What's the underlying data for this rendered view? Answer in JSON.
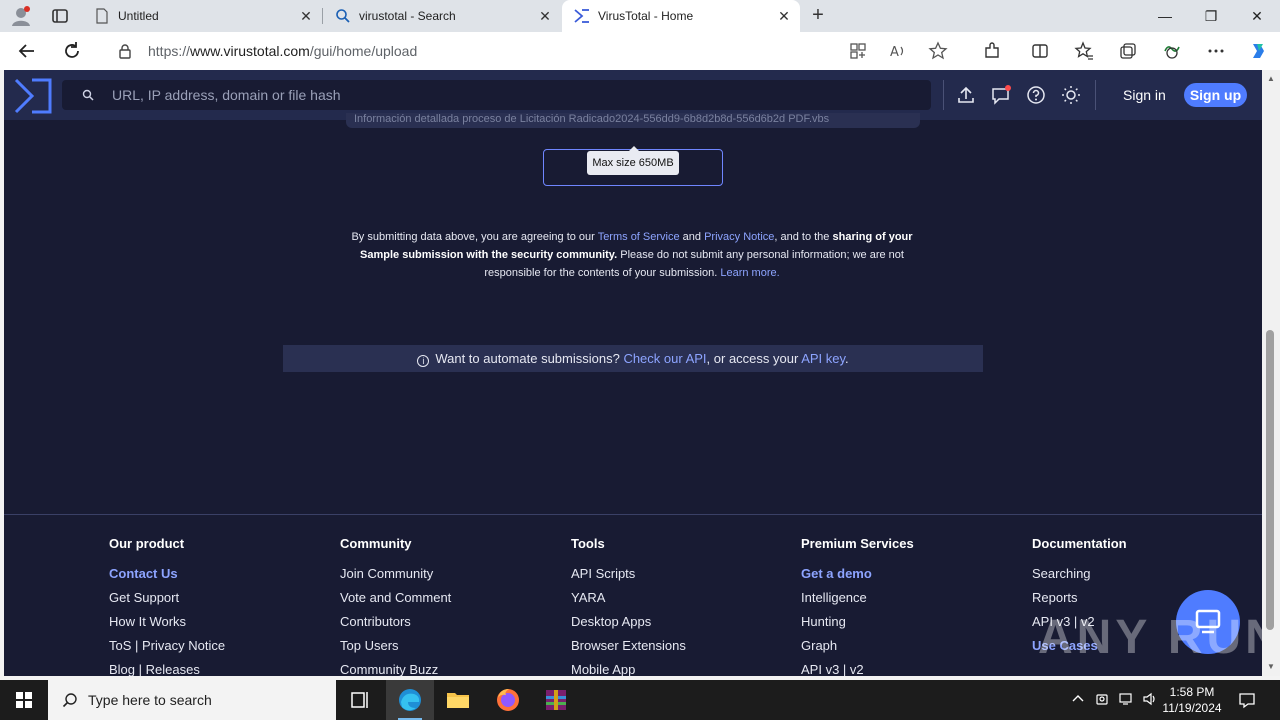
{
  "browser": {
    "tabs": [
      {
        "title": "Untitled",
        "icon": "page-icon"
      },
      {
        "title": "virustotal - Search",
        "icon": "search-icon"
      },
      {
        "title": "VirusTotal - Home",
        "icon": "virustotal-logo-icon"
      }
    ],
    "url_prefix": "https://",
    "url_domain": "www.virustotal.com",
    "url_path": "/gui/home/upload"
  },
  "vt": {
    "search_placeholder": "URL, IP address, domain or file hash",
    "signin_label": "Sign in",
    "signup_label": "Sign up",
    "accent_color": "#4f7cff",
    "header_bg": "#232a4d",
    "page_bg": "#181b33"
  },
  "upload": {
    "file_chip_text": "Información detallada proceso de Licitación Radicado2024-556dd9-6b8d2b8d-556d6b2d PDF.vbs",
    "tooltip": "Max size 650MB"
  },
  "terms": {
    "t1": "By submitting data above, you are agreeing to our ",
    "tos": "Terms of Service",
    "t2": " and ",
    "privacy": "Privacy Notice",
    "t3": ", and to the ",
    "sharing": "sharing of your Sample submission with the security community.",
    "t4": " Please do not submit any personal information; we are not responsible for the contents of your submission. ",
    "learn": "Learn more."
  },
  "api_banner": {
    "t1": "Want to automate submissions? ",
    "check_api": "Check our API",
    "t2": ", or access your ",
    "api_key": "API key",
    "t3": "."
  },
  "footer": {
    "columns": [
      {
        "heading": "Our product",
        "links": [
          "Contact Us",
          "Get Support",
          "How It Works",
          "ToS | Privacy Notice",
          "Blog | Releases"
        ]
      },
      {
        "heading": "Community",
        "links": [
          "Join Community",
          "Vote and Comment",
          "Contributors",
          "Top Users",
          "Community Buzz"
        ]
      },
      {
        "heading": "Tools",
        "links": [
          "API Scripts",
          "YARA",
          "Desktop Apps",
          "Browser Extensions",
          "Mobile App"
        ]
      },
      {
        "heading": "Premium Services",
        "links": [
          "Get a demo",
          "Intelligence",
          "Hunting",
          "Graph",
          "API v3 | v2"
        ]
      },
      {
        "heading": "Documentation",
        "links": [
          "Searching",
          "Reports",
          "API v3 | v2",
          "Use Cases"
        ]
      }
    ]
  },
  "watermark": "ANY RUN",
  "taskbar": {
    "search_placeholder": "Type here to search",
    "time": "1:58 PM",
    "date": "11/19/2024"
  }
}
